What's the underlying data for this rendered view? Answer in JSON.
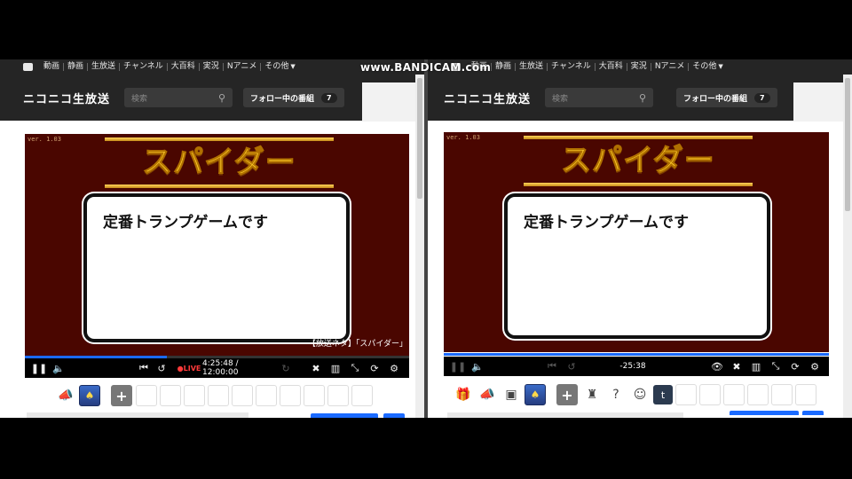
{
  "colors": {
    "accent_blue": "#1a6aff",
    "live_red": "#ff3a3a",
    "player_bg": "#4a0600",
    "title_gold": "#ffce2a"
  },
  "watermark": "www.BANDICAM.com",
  "nav": {
    "items": [
      "動画",
      "静画",
      "生放送",
      "チャンネル",
      "大百科",
      "実況",
      "Nアニメ",
      "その他"
    ],
    "more_icon": "chevron-down-icon"
  },
  "header": {
    "brand": "ニコニコ生放送",
    "search_placeholder": "検索",
    "follow_label": "フォロー中の番組",
    "follow_count": "7"
  },
  "left": {
    "version": "ver. 1.03",
    "game_title": "スパイダー",
    "card_text": "定番トランプゲームです",
    "ticker": "【放送ネタ】「スパイダー」",
    "live_label": "●LIVE",
    "time": "4:25:48 / 12:00:00",
    "progress": 0.37
  },
  "right": {
    "version": "ver. 1.03",
    "game_title": "スパイダー",
    "card_text": "定番トランプゲームです",
    "time": "-25:38"
  },
  "toolbar": {
    "add_label": "+",
    "twitter_glyph": "t"
  }
}
